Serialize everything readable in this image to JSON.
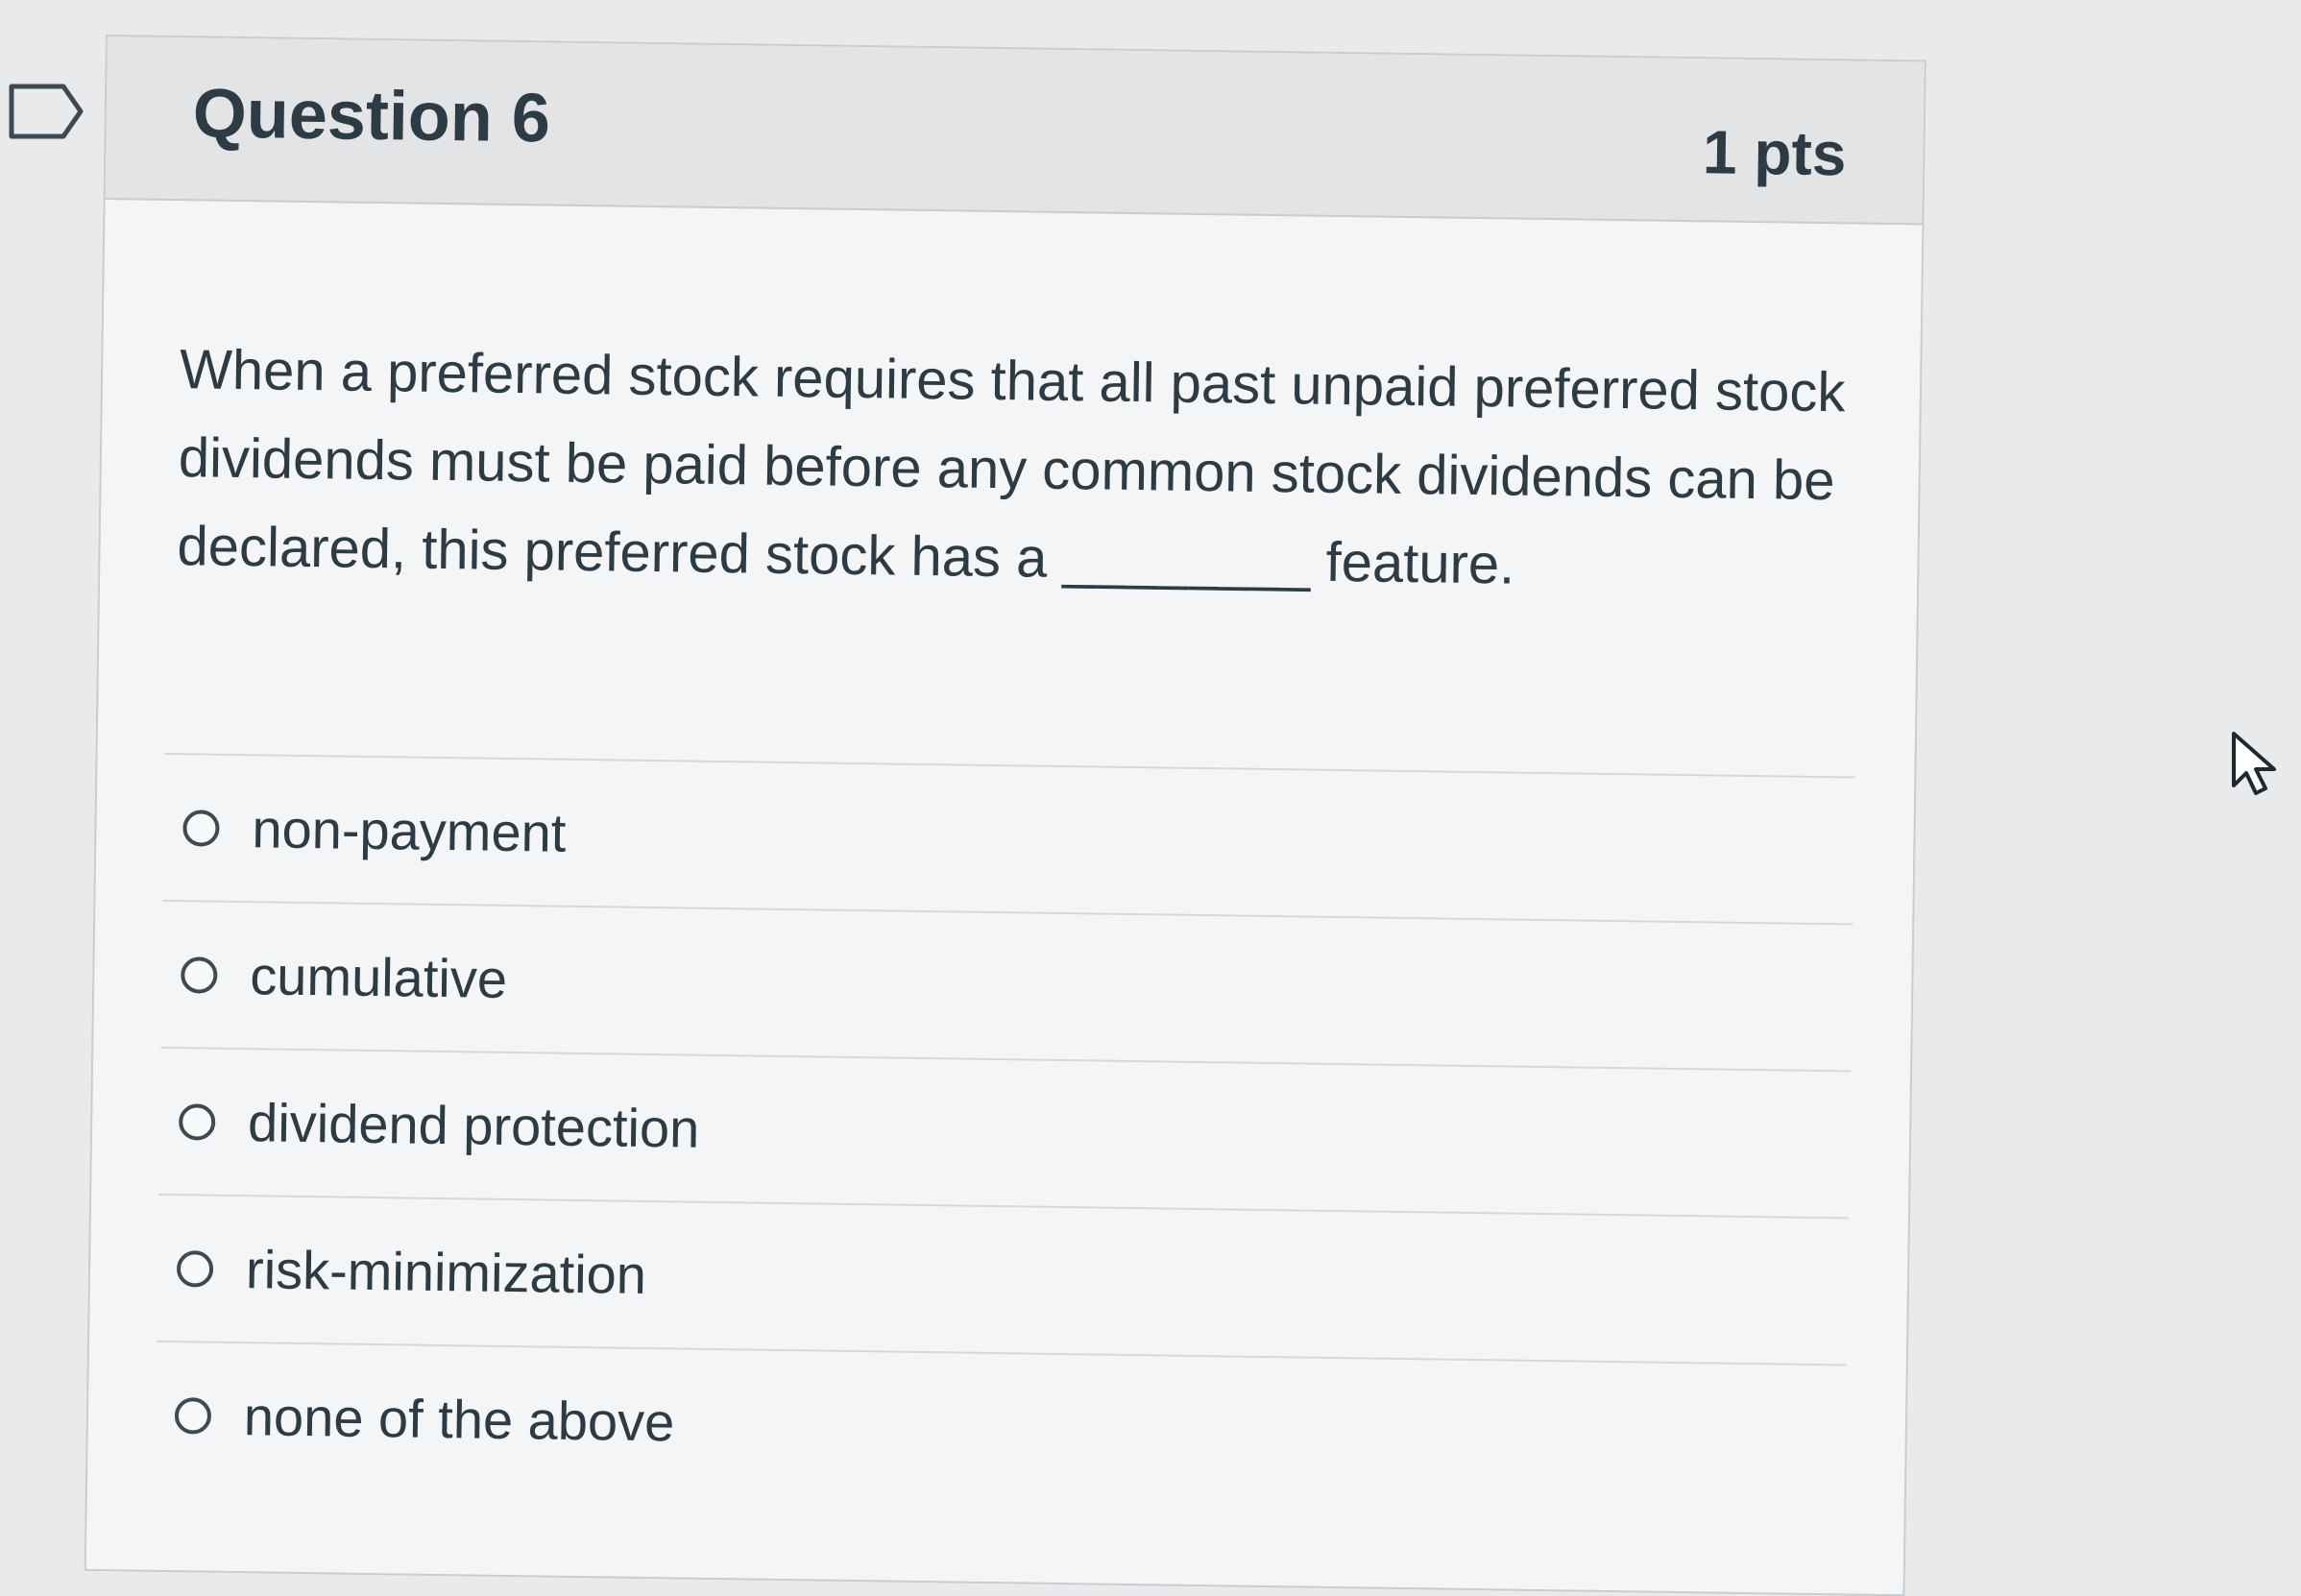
{
  "question": {
    "title": "Question 6",
    "points": "1 pts",
    "text": "When a preferred stock requires that all past unpaid preferred stock dividends must be paid before any common stock dividends can be declared, this preferred stock has a ________ feature."
  },
  "answers": [
    {
      "label": "non-payment",
      "selected": false
    },
    {
      "label": "cumulative",
      "selected": false
    },
    {
      "label": "dividend protection",
      "selected": false
    },
    {
      "label": "risk-minimization",
      "selected": false
    },
    {
      "label": "none of the above",
      "selected": false
    }
  ],
  "icons": {
    "bookmark": "bookmark-flag-icon",
    "cursor": "mouse-pointer-icon"
  },
  "colors": {
    "text": "#2d3b45",
    "header_bg": "#e2e4e6",
    "card_bg": "#f4f5f6",
    "border": "#c7cdd1"
  }
}
